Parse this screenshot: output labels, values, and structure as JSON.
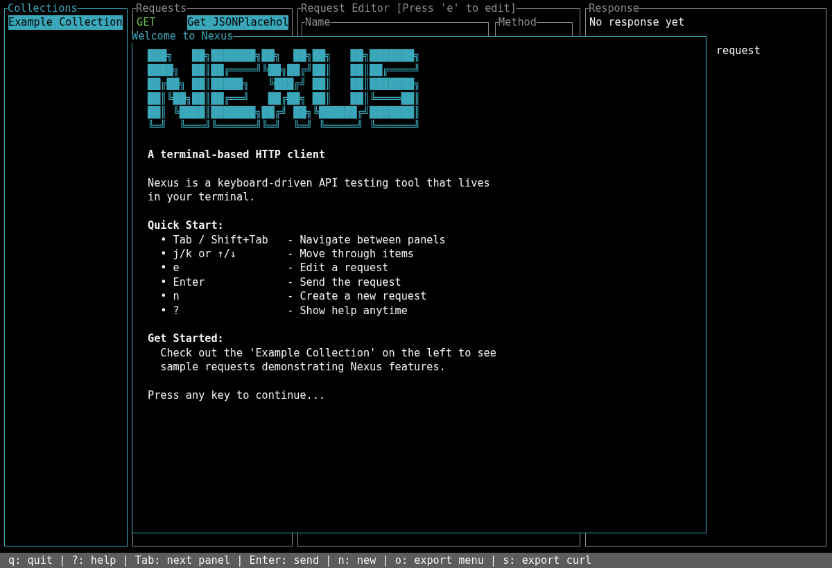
{
  "collections": {
    "title": "Collections",
    "items": [
      {
        "label": "Example Collection",
        "selected": true
      }
    ]
  },
  "requests": {
    "title": "Requests",
    "items": [
      {
        "method": "GET",
        "color": "#6cbf4c",
        "name": "Get JSONPlacehol",
        "selected": true
      }
    ]
  },
  "request_editor": {
    "title": "Request Editor [Press 'e' to edit]",
    "fields": [
      {
        "label": "Name"
      },
      {
        "label": "Method"
      }
    ]
  },
  "response": {
    "title": "Response",
    "message": "No response yet",
    "partial_text": "request"
  },
  "dialog": {
    "title": "Welcome to Nexus",
    "logo_lines": [
      "███╗   ██╗███████╗██╗  ██╗██╗   ██╗███████╗",
      "████╗  ██║██╔════╝╚██╗██╔╝██║   ██║██╔════╝",
      "██╔██╗ ██║█████╗   ╚███╔╝ ██║   ██║███████╗",
      "██║╚██╗██║██╔══╝   ██╔██╗ ██║   ██║╚════██║",
      "██║ ╚████║███████╗██╔╝ ██╗╚██████╔╝███████║",
      "╚═╝  ╚═══╝╚══════╝╚═╝  ╚═╝ ╚═════╝ ╚══════╝"
    ],
    "tagline": "A terminal-based HTTP client",
    "intro": "Nexus is a keyboard-driven API testing tool that lives in your terminal.",
    "quick_start_heading": "Quick Start:",
    "shortcuts": [
      {
        "bullet": "•",
        "key": "Tab / Shift+Tab",
        "description": "- Navigate between panels"
      },
      {
        "bullet": "•",
        "key": "j/k or ↑/↓",
        "description": "- Move through items"
      },
      {
        "bullet": "•",
        "key": "e",
        "description": "- Edit a request"
      },
      {
        "bullet": "•",
        "key": "Enter",
        "description": "- Send the request"
      },
      {
        "bullet": "•",
        "key": "n",
        "description": "- Create a new request"
      },
      {
        "bullet": "•",
        "key": "?",
        "description": "- Show help anytime"
      }
    ],
    "get_started_heading": "Get Started:",
    "get_started_text": "Check out the 'Example Collection' on the left to see sample requests demonstrating Nexus features.",
    "continue_prompt": "Press any key to continue..."
  },
  "status_bar": "q: quit | ?: help | Tab: next panel | Enter: send | n: new | o: export menu | s: export curl"
}
